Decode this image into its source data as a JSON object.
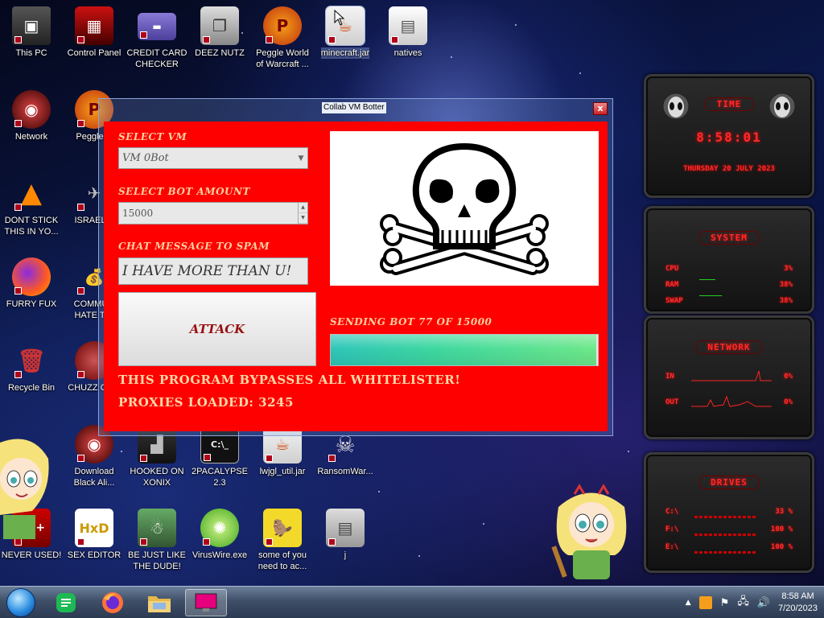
{
  "desktop": {
    "icons": [
      {
        "label": "This PC"
      },
      {
        "label": "Control Panel"
      },
      {
        "label": "CREDIT CARD CHECKER"
      },
      {
        "label": "DEEZ NUTZ"
      },
      {
        "label": "Peggle World of Warcraft ..."
      },
      {
        "label": "minecraft.jar"
      },
      {
        "label": "natives"
      },
      {
        "label": "Network"
      },
      {
        "label": "Peggle D"
      },
      {
        "label": "DONT STICK THIS IN YO..."
      },
      {
        "label": "ISRAEL S"
      },
      {
        "label": "FURRY FUX"
      },
      {
        "label": "COMMUN HATE THI"
      },
      {
        "label": "Recycle Bin"
      },
      {
        "label": "CHUZZ CUM"
      },
      {
        "label": "Download Black Ali..."
      },
      {
        "label": "HOOKED ON XONIX"
      },
      {
        "label": "2PACALYPSE 2.3"
      },
      {
        "label": "lwjgl_util.jar"
      },
      {
        "label": "RansomWar..."
      },
      {
        "label": "NEVER USED!"
      },
      {
        "label": "SEX EDITOR"
      },
      {
        "label": "BE JUST LIKE THE DUDE!"
      },
      {
        "label": "VirusWire.exe"
      },
      {
        "label": "some of you need to ac..."
      },
      {
        "label": "j"
      }
    ]
  },
  "window": {
    "title": "Collab VM Botter",
    "close_label": "x",
    "select_vm_label": "SELECT VM",
    "select_vm_value": "VM 0Bot",
    "bot_amount_label": "SELECT BOT AMOUNT",
    "bot_amount_value": "15000",
    "chat_label": "CHAT MESSAGE TO SPAM",
    "chat_value": "I HAVE MORE THAN U!",
    "attack_label": "ATTACK",
    "progress_label": "SENDING BOT 77 OF 15000",
    "progress_fraction": 0.995,
    "bypass_text": "THIS PROGRAM BYPASSES ALL WHITELISTER!",
    "proxies_text": "PROXIES LOADED: 3245"
  },
  "gadgets": {
    "time": {
      "title": "TIME",
      "clock": "8:58:01",
      "date": "THURSDAY 20 JULY 2023"
    },
    "system": {
      "title": "SYSTEM",
      "rows": [
        {
          "k": "CPU",
          "v": "3%"
        },
        {
          "k": "RAM",
          "v": "38%"
        },
        {
          "k": "SWAP",
          "v": "38%"
        }
      ]
    },
    "network": {
      "title": "NETWORK",
      "rows": [
        {
          "k": "IN",
          "v": "0%"
        },
        {
          "k": "OUT",
          "v": "0%"
        }
      ]
    },
    "drives": {
      "title": "DRIVES",
      "rows": [
        {
          "k": "C:\\",
          "v": "33 %"
        },
        {
          "k": "F:\\",
          "v": "100 %"
        },
        {
          "k": "E:\\",
          "v": "100 %"
        }
      ]
    }
  },
  "taskbar": {
    "time": "8:58 AM",
    "date": "7/20/2023"
  }
}
